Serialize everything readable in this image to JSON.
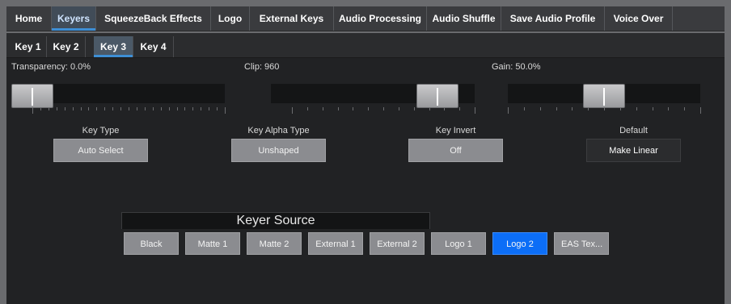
{
  "top_tabs": [
    {
      "label": "Home",
      "active": false
    },
    {
      "label": "Keyers",
      "active": true
    },
    {
      "label": "SqueezeBack Effects",
      "active": false
    },
    {
      "label": "Logo",
      "active": false
    },
    {
      "label": "External Keys",
      "active": false
    },
    {
      "label": "Audio Processing",
      "active": false
    },
    {
      "label": "Audio Shuffle",
      "active": false
    },
    {
      "label": "Save Audio Profile",
      "active": false
    },
    {
      "label": "Voice Over",
      "active": false
    }
  ],
  "key_tabs": [
    {
      "label": "Key 1",
      "active": false
    },
    {
      "label": "Key 2",
      "active": false
    },
    {
      "label": "Key 3",
      "active": true
    },
    {
      "label": "Key 4",
      "active": false
    }
  ],
  "sliders": {
    "transparency": {
      "label": "Transparency: 0.0%",
      "value": 0.0,
      "fraction": 0.0
    },
    "clip": {
      "label": "Clip: 960",
      "value": 960,
      "fraction": 0.9
    },
    "gain": {
      "label": "Gain: 50.0%",
      "value": 50.0,
      "fraction": 0.5
    }
  },
  "options": {
    "key_type": {
      "label": "Key Type",
      "value": "Auto Select"
    },
    "key_alpha_type": {
      "label": "Key Alpha Type",
      "value": "Unshaped"
    },
    "key_invert": {
      "label": "Key Invert",
      "value": "Off"
    },
    "default": {
      "label": "Default",
      "value": "Make Linear"
    }
  },
  "keyer_source": {
    "title": "Keyer Source",
    "selected": "Logo 2",
    "buttons": [
      "Black",
      "Matte 1",
      "Matte 2",
      "External 1",
      "External 2",
      "Logo 1",
      "Logo 2",
      "EAS Tex..."
    ]
  },
  "colors": {
    "accent": "#3d8fd6",
    "selected": "#0c6ef7",
    "button": "#8b8c90",
    "panel": "#212224"
  }
}
